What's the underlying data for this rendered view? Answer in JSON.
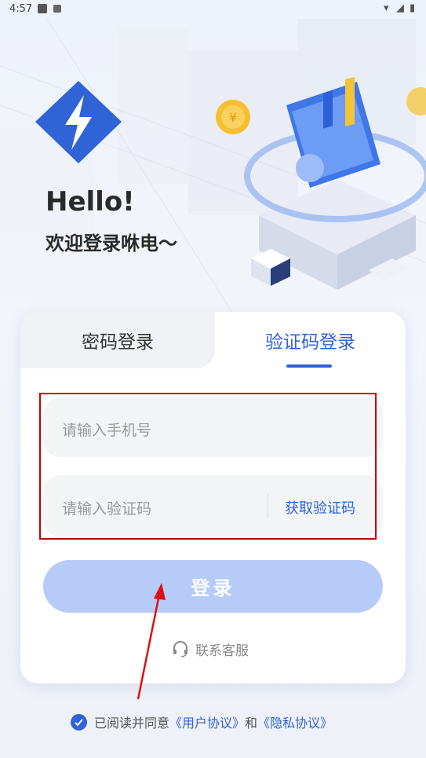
{
  "status_bar": {
    "time": "4:57"
  },
  "header": {
    "hello": "Hello!",
    "welcome": "欢迎登录咻电～"
  },
  "tabs": [
    {
      "label": "密码登录",
      "active": false
    },
    {
      "label": "验证码登录",
      "active": true
    }
  ],
  "form": {
    "phone_placeholder": "请输入手机号",
    "code_placeholder": "请输入验证码",
    "get_code_label": "获取验证码"
  },
  "login_button": {
    "label": "登录"
  },
  "service": {
    "label": "联系客服"
  },
  "agreement": {
    "prefix": "已阅读并同意",
    "user_agreement": "《用户协议》",
    "and": "和",
    "privacy_agreement": "《隐私协议》",
    "checked": true
  },
  "colors": {
    "accent": "#2f63d6",
    "button_disabled": "#b6cbf7",
    "annotation": "#c40000"
  },
  "icons": {
    "logo": "lightning-logo-icon",
    "service": "headset-icon",
    "check": "check-circle-icon"
  }
}
